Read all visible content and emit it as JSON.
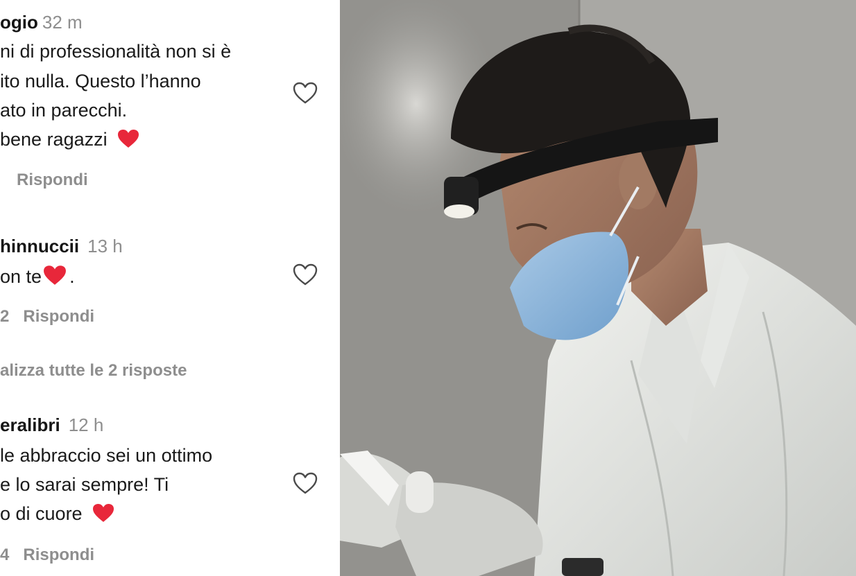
{
  "comments": [
    {
      "username": "ogio",
      "time": "32 m",
      "lines": [
        "ni di professionalità non si è",
        "ito nulla. Questo l’hanno",
        "ato in parecchi.",
        "bene ragazzi"
      ],
      "likes": "",
      "reply_label": "Rispondi",
      "heart_emoji_color": "#e8273a"
    },
    {
      "username": "hinnuccii",
      "time": "13 h",
      "lines": [
        "on te",
        "."
      ],
      "likes": "2",
      "reply_label": "Rispondi",
      "heart_emoji_color": "#e8273a"
    },
    {
      "username": "eralibri",
      "time": "12 h",
      "lines": [
        "le abbraccio sei un ottimo",
        "e lo sarai sempre! Ti",
        "o di cuore"
      ],
      "likes": "4",
      "reply_label": "Rispondi",
      "heart_emoji_color": "#e8273a"
    }
  ],
  "view_replies_label": "alizza tutte le 2 risposte",
  "like_icon": "heart-outline-icon",
  "colors": {
    "text": "#1a1a1a",
    "secondary_text": "#8e8e8e",
    "heart": "#e8273a",
    "background": "#ffffff"
  },
  "photo": {
    "subject": "dentist-with-headlamp-and-mask"
  }
}
